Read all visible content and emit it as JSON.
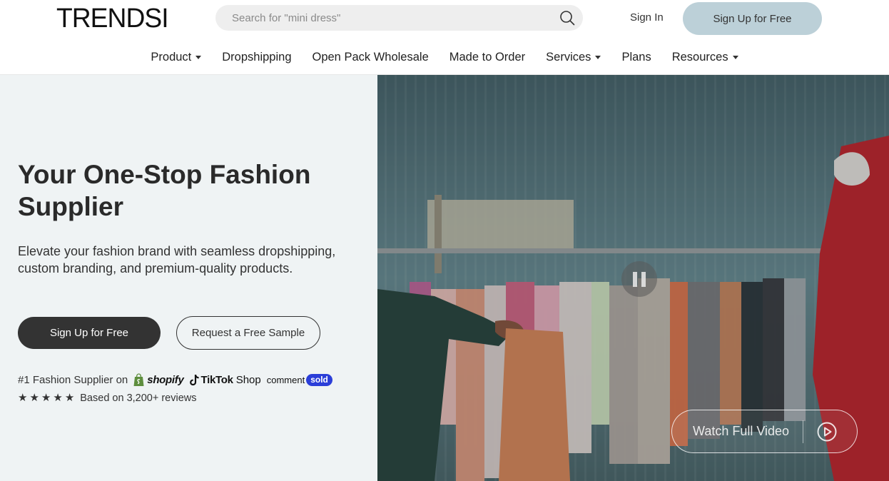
{
  "header": {
    "logo": "TRENDSI",
    "search_placeholder": "Search for \"mini dress\"",
    "sign_in": "Sign In",
    "sign_up": "Sign Up for Free"
  },
  "nav": {
    "items": [
      {
        "label": "Product",
        "dropdown": true
      },
      {
        "label": "Dropshipping",
        "dropdown": false
      },
      {
        "label": "Open Pack Wholesale",
        "dropdown": false
      },
      {
        "label": "Made to Order",
        "dropdown": false
      },
      {
        "label": "Services",
        "dropdown": true
      },
      {
        "label": "Plans",
        "dropdown": false
      },
      {
        "label": "Resources",
        "dropdown": true
      }
    ]
  },
  "hero": {
    "title": "Your One-Stop Fashion Supplier",
    "subtitle": "Elevate your fashion brand with seamless dropshipping, custom branding, and premium-quality products.",
    "primary_cta": "Sign Up for Free",
    "secondary_cta": "Request a Free Sample",
    "supplier_prefix": "#1 Fashion Supplier on",
    "platforms": {
      "shopify": "shopify",
      "tiktok": "TikTok",
      "tiktok_shop": "Shop",
      "comment": "comment",
      "sold": "sold"
    },
    "rating_stars": 5,
    "reviews_text": "Based on 3,200+ reviews"
  },
  "video": {
    "watch_label": "Watch Full Video",
    "state": "playing"
  },
  "colors": {
    "hero_bg": "#eff3f4",
    "signup_top_bg": "#bcd0d8",
    "primary_dark": "#333333",
    "commentsold_blue": "#2b3ed8"
  }
}
